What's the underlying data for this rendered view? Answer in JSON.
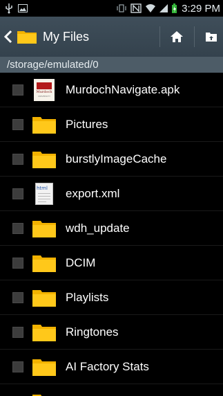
{
  "status_bar": {
    "time": "3:29 PM",
    "battery_icon": "battery-charging-icon",
    "signal_icon": "signal-icon",
    "wifi_icon": "wifi-icon"
  },
  "action_bar": {
    "title": "My Files",
    "home_icon": "home-icon",
    "up_icon": "folder-up-icon"
  },
  "path_bar": {
    "path": "/storage/emulated/0"
  },
  "files": [
    {
      "name": "MurdochNavigate.apk",
      "icon": "apk-icon",
      "logo_text": "Murdoch",
      "logo_sub": "UNIVERSITY"
    },
    {
      "name": "Pictures",
      "icon": "folder-icon"
    },
    {
      "name": "burstlyImageCache",
      "icon": "folder-icon"
    },
    {
      "name": "export.xml",
      "icon": "html-file-icon",
      "badge": "html"
    },
    {
      "name": "wdh_update",
      "icon": "folder-icon"
    },
    {
      "name": "DCIM",
      "icon": "folder-icon"
    },
    {
      "name": "Playlists",
      "icon": "folder-icon"
    },
    {
      "name": "Ringtones",
      "icon": "folder-icon"
    },
    {
      "name": "AI Factory Stats",
      "icon": "folder-icon"
    }
  ],
  "colors": {
    "action_bar": "#3a4853",
    "path_bar": "#4d5c67",
    "folder": "#f5b800",
    "background": "#000000"
  }
}
